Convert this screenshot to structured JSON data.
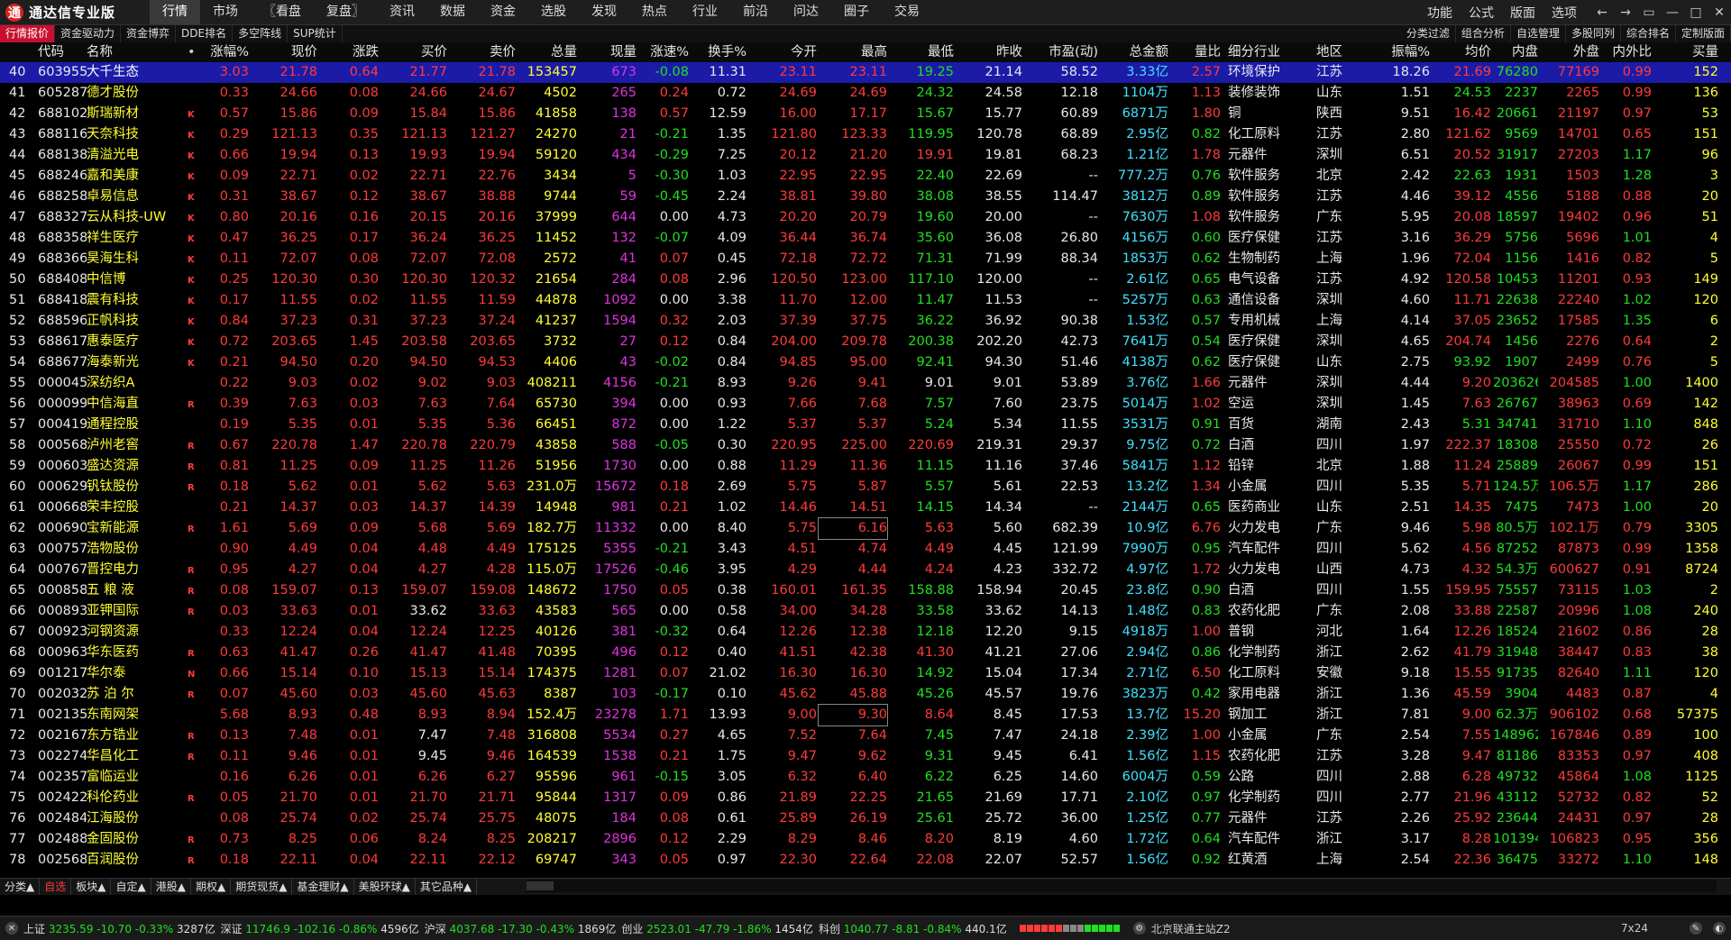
{
  "app": {
    "title": "通达信专业版",
    "logo_glyph": "通"
  },
  "menu": {
    "items": [
      "行情",
      "市场",
      "〖看盘",
      "复盘〗",
      "资讯",
      "数据",
      "资金",
      "选股",
      "发现",
      "热点",
      "行业",
      "前沿",
      "问达",
      "圈子",
      "交易"
    ],
    "active": 0
  },
  "right_menu": {
    "items": [
      "功能",
      "公式",
      "版面",
      "选项"
    ]
  },
  "window_controls": [
    "←",
    "→",
    "▭",
    "—",
    "□",
    "✕"
  ],
  "toolbar": {
    "left": [
      "行情报价",
      "资金驱动力",
      "资金博弈",
      "DDE排名",
      "多空阵线",
      "SUP统计"
    ],
    "right": [
      "分类过滤",
      "组合分析",
      "自选管理",
      "多股同列",
      "综合排名",
      "定制版面"
    ]
  },
  "columns": [
    "",
    "代码",
    "名称",
    "",
    "涨幅%",
    "现价",
    "涨跌",
    "买价",
    "卖价",
    "总量",
    "现量",
    "涨速%",
    "换手%",
    "今开",
    "最高",
    "最低",
    "昨收",
    "市盈(动)",
    "总金额",
    "量比",
    "细分行业",
    "地区",
    "振幅%",
    "均价",
    "内盘",
    "外盘",
    "内外比",
    "买量"
  ],
  "rows": [
    [
      "40",
      "603955",
      "大千生态",
      "",
      "3.03",
      "21.78",
      "0.64",
      "21.77",
      "21.78",
      "153457",
      "673",
      "-0.08",
      "11.31",
      "23.11",
      "23.11",
      "19.25",
      "21.14",
      "58.52",
      "3.33亿",
      "2.57",
      "环境保护",
      "江苏",
      "18.26",
      "21.69",
      "76280",
      "77169",
      "0.99",
      "152"
    ],
    [
      "41",
      "605287",
      "德才股份",
      "",
      "0.33",
      "24.66",
      "0.08",
      "24.66",
      "24.67",
      "4502",
      "265",
      "0.24",
      "0.72",
      "24.69",
      "24.69",
      "24.32",
      "24.58",
      "12.18",
      "1104万",
      "1.13",
      "装修装饰",
      "山东",
      "1.51",
      "24.53",
      "2237",
      "2265",
      "0.99",
      "136"
    ],
    [
      "42",
      "688102",
      "斯瑞新材",
      "K",
      "0.57",
      "15.86",
      "0.09",
      "15.84",
      "15.86",
      "41858",
      "138",
      "0.57",
      "12.59",
      "16.00",
      "17.17",
      "15.67",
      "15.77",
      "60.89",
      "6871万",
      "1.80",
      "铜",
      "陕西",
      "9.51",
      "16.42",
      "20661",
      "21197",
      "0.97",
      "53"
    ],
    [
      "43",
      "688116",
      "天奈科技",
      "K",
      "0.29",
      "121.13",
      "0.35",
      "121.13",
      "121.27",
      "24270",
      "21",
      "-0.21",
      "1.35",
      "121.80",
      "123.33",
      "119.95",
      "120.78",
      "68.89",
      "2.95亿",
      "0.82",
      "化工原料",
      "江苏",
      "2.80",
      "121.62",
      "9569",
      "14701",
      "0.65",
      "151"
    ],
    [
      "44",
      "688138",
      "清溢光电",
      "K",
      "0.66",
      "19.94",
      "0.13",
      "19.93",
      "19.94",
      "59120",
      "434",
      "-0.29",
      "7.25",
      "20.12",
      "21.20",
      "19.91",
      "19.81",
      "68.23",
      "1.21亿",
      "1.78",
      "元器件",
      "深圳",
      "6.51",
      "20.52",
      "31917",
      "27203",
      "1.17",
      "96"
    ],
    [
      "45",
      "688246",
      "嘉和美康",
      "K",
      "0.09",
      "22.71",
      "0.02",
      "22.71",
      "22.76",
      "3434",
      "5",
      "-0.30",
      "1.03",
      "22.95",
      "22.95",
      "22.40",
      "22.69",
      "--",
      "777.2万",
      "0.76",
      "软件服务",
      "北京",
      "2.42",
      "22.63",
      "1931",
      "1503",
      "1.28",
      "3"
    ],
    [
      "46",
      "688258",
      "卓易信息",
      "K",
      "0.31",
      "38.67",
      "0.12",
      "38.67",
      "38.88",
      "9744",
      "59",
      "-0.45",
      "2.24",
      "38.81",
      "39.80",
      "38.08",
      "38.55",
      "114.47",
      "3812万",
      "0.89",
      "软件服务",
      "江苏",
      "4.46",
      "39.12",
      "4556",
      "5188",
      "0.88",
      "20"
    ],
    [
      "47",
      "688327",
      "云从科技-UW",
      "K",
      "0.80",
      "20.16",
      "0.16",
      "20.15",
      "20.16",
      "37999",
      "644",
      "0.00",
      "4.73",
      "20.20",
      "20.79",
      "19.60",
      "20.00",
      "--",
      "7630万",
      "1.08",
      "软件服务",
      "广东",
      "5.95",
      "20.08",
      "18597",
      "19402",
      "0.96",
      "51"
    ],
    [
      "48",
      "688358",
      "祥生医疗",
      "K",
      "0.47",
      "36.25",
      "0.17",
      "36.24",
      "36.25",
      "11452",
      "132",
      "-0.07",
      "4.09",
      "36.44",
      "36.74",
      "35.60",
      "36.08",
      "26.80",
      "4156万",
      "0.60",
      "医疗保健",
      "江苏",
      "3.16",
      "36.29",
      "5756",
      "5696",
      "1.01",
      "4"
    ],
    [
      "49",
      "688366",
      "昊海生科",
      "K",
      "0.11",
      "72.07",
      "0.08",
      "72.07",
      "72.08",
      "2572",
      "41",
      "0.07",
      "0.45",
      "72.18",
      "72.72",
      "71.31",
      "71.99",
      "88.34",
      "1853万",
      "0.62",
      "生物制药",
      "上海",
      "1.96",
      "72.04",
      "1156",
      "1416",
      "0.82",
      "5"
    ],
    [
      "50",
      "688408",
      "中信博",
      "K",
      "0.25",
      "120.30",
      "0.30",
      "120.30",
      "120.32",
      "21654",
      "284",
      "0.08",
      "2.96",
      "120.50",
      "123.00",
      "117.10",
      "120.00",
      "--",
      "2.61亿",
      "0.65",
      "电气设备",
      "江苏",
      "4.92",
      "120.58",
      "10453",
      "11201",
      "0.93",
      "149"
    ],
    [
      "51",
      "688418",
      "震有科技",
      "K",
      "0.17",
      "11.55",
      "0.02",
      "11.55",
      "11.59",
      "44878",
      "1092",
      "0.00",
      "3.38",
      "11.70",
      "12.00",
      "11.47",
      "11.53",
      "--",
      "5257万",
      "0.63",
      "通信设备",
      "深圳",
      "4.60",
      "11.71",
      "22638",
      "22240",
      "1.02",
      "120"
    ],
    [
      "52",
      "688596",
      "正帆科技",
      "K",
      "0.84",
      "37.23",
      "0.31",
      "37.23",
      "37.24",
      "41237",
      "1594",
      "0.32",
      "2.03",
      "37.39",
      "37.75",
      "36.22",
      "36.92",
      "90.38",
      "1.53亿",
      "0.57",
      "专用机械",
      "上海",
      "4.14",
      "37.05",
      "23652",
      "17585",
      "1.35",
      "6"
    ],
    [
      "53",
      "688617",
      "惠泰医疗",
      "K",
      "0.72",
      "203.65",
      "1.45",
      "203.58",
      "203.65",
      "3732",
      "27",
      "0.12",
      "0.84",
      "204.00",
      "209.78",
      "200.38",
      "202.20",
      "42.73",
      "7641万",
      "0.54",
      "医疗保健",
      "深圳",
      "4.65",
      "204.74",
      "1456",
      "2276",
      "0.64",
      "2"
    ],
    [
      "54",
      "688677",
      "海泰新光",
      "K",
      "0.21",
      "94.50",
      "0.20",
      "94.50",
      "94.53",
      "4406",
      "43",
      "-0.02",
      "0.84",
      "94.85",
      "95.00",
      "92.41",
      "94.30",
      "51.46",
      "4138万",
      "0.62",
      "医疗保健",
      "山东",
      "2.75",
      "93.92",
      "1907",
      "2499",
      "0.76",
      "5"
    ],
    [
      "55",
      "000045",
      "深纺织A",
      "",
      "0.22",
      "9.03",
      "0.02",
      "9.02",
      "9.03",
      "408211",
      "4156",
      "-0.21",
      "8.93",
      "9.26",
      "9.41",
      "9.01",
      "9.01",
      "53.89",
      "3.76亿",
      "1.66",
      "元器件",
      "深圳",
      "4.44",
      "9.20",
      "203626",
      "204585",
      "1.00",
      "1400"
    ],
    [
      "56",
      "000099",
      "中信海直",
      "R",
      "0.39",
      "7.63",
      "0.03",
      "7.63",
      "7.64",
      "65730",
      "394",
      "0.00",
      "0.93",
      "7.66",
      "7.68",
      "7.57",
      "7.60",
      "23.75",
      "5014万",
      "1.02",
      "空运",
      "深圳",
      "1.45",
      "7.63",
      "26767",
      "38963",
      "0.69",
      "142"
    ],
    [
      "57",
      "000419",
      "通程控股",
      "",
      "0.19",
      "5.35",
      "0.01",
      "5.35",
      "5.36",
      "66451",
      "872",
      "0.00",
      "1.22",
      "5.37",
      "5.37",
      "5.24",
      "5.34",
      "11.55",
      "3531万",
      "0.91",
      "百货",
      "湖南",
      "2.43",
      "5.31",
      "34741",
      "31710",
      "1.10",
      "848"
    ],
    [
      "58",
      "000568",
      "泸州老窖",
      "R",
      "0.67",
      "220.78",
      "1.47",
      "220.78",
      "220.79",
      "43858",
      "588",
      "-0.05",
      "0.30",
      "220.95",
      "225.00",
      "220.69",
      "219.31",
      "29.37",
      "9.75亿",
      "0.72",
      "白酒",
      "四川",
      "1.97",
      "222.37",
      "18308",
      "25550",
      "0.72",
      "26"
    ],
    [
      "59",
      "000603",
      "盛达资源",
      "R",
      "0.81",
      "11.25",
      "0.09",
      "11.25",
      "11.26",
      "51956",
      "1730",
      "0.00",
      "0.88",
      "11.29",
      "11.36",
      "11.15",
      "11.16",
      "37.46",
      "5841万",
      "1.12",
      "铅锌",
      "北京",
      "1.88",
      "11.24",
      "25889",
      "26067",
      "0.99",
      "151"
    ],
    [
      "60",
      "000629",
      "钒钛股份",
      "R",
      "0.18",
      "5.62",
      "0.01",
      "5.62",
      "5.63",
      "231.0万",
      "15672",
      "0.18",
      "2.69",
      "5.75",
      "5.87",
      "5.57",
      "5.61",
      "22.53",
      "13.2亿",
      "1.34",
      "小金属",
      "四川",
      "5.35",
      "5.71",
      "124.5万",
      "106.5万",
      "1.17",
      "286"
    ],
    [
      "61",
      "000668",
      "荣丰控股",
      "",
      "0.21",
      "14.37",
      "0.03",
      "14.37",
      "14.39",
      "14948",
      "981",
      "0.21",
      "1.02",
      "14.46",
      "14.51",
      "14.15",
      "14.34",
      "--",
      "2144万",
      "0.65",
      "医药商业",
      "山东",
      "2.51",
      "14.35",
      "7475",
      "7473",
      "1.00",
      "20"
    ],
    [
      "62",
      "000690",
      "宝新能源",
      "R",
      "1.61",
      "5.69",
      "0.09",
      "5.68",
      "5.69",
      "182.7万",
      "11332",
      "0.00",
      "8.40",
      "5.75",
      "6.16",
      "5.63",
      "5.60",
      "682.39",
      "10.9亿",
      "6.76",
      "火力发电",
      "广东",
      "9.46",
      "5.98",
      "80.5万",
      "102.1万",
      "0.79",
      "3305"
    ],
    [
      "63",
      "000757",
      "浩物股份",
      "",
      "0.90",
      "4.49",
      "0.04",
      "4.48",
      "4.49",
      "175125",
      "5355",
      "-0.21",
      "3.43",
      "4.51",
      "4.74",
      "4.49",
      "4.45",
      "121.99",
      "7990万",
      "0.95",
      "汽车配件",
      "四川",
      "5.62",
      "4.56",
      "87252",
      "87873",
      "0.99",
      "1358"
    ],
    [
      "64",
      "000767",
      "晋控电力",
      "R",
      "0.95",
      "4.27",
      "0.04",
      "4.27",
      "4.28",
      "115.0万",
      "17526",
      "-0.46",
      "3.95",
      "4.29",
      "4.44",
      "4.24",
      "4.23",
      "332.72",
      "4.97亿",
      "1.72",
      "火力发电",
      "山西",
      "4.73",
      "4.32",
      "54.3万",
      "600627",
      "0.91",
      "8724"
    ],
    [
      "65",
      "000858",
      "五 粮 液",
      "R",
      "0.08",
      "159.07",
      "0.13",
      "159.07",
      "159.08",
      "148672",
      "1750",
      "0.05",
      "0.38",
      "160.01",
      "161.35",
      "158.88",
      "158.94",
      "20.45",
      "23.8亿",
      "0.90",
      "白酒",
      "四川",
      "1.55",
      "159.95",
      "75557",
      "73115",
      "1.03",
      "2"
    ],
    [
      "66",
      "000893",
      "亚钾国际",
      "R",
      "0.03",
      "33.63",
      "0.01",
      "33.62",
      "33.63",
      "43583",
      "565",
      "0.00",
      "0.58",
      "34.00",
      "34.28",
      "33.58",
      "33.62",
      "14.13",
      "1.48亿",
      "0.83",
      "农药化肥",
      "广东",
      "2.08",
      "33.88",
      "22587",
      "20996",
      "1.08",
      "240"
    ],
    [
      "67",
      "000923",
      "河钢资源",
      "",
      "0.33",
      "12.24",
      "0.04",
      "12.24",
      "12.25",
      "40126",
      "381",
      "-0.32",
      "0.64",
      "12.26",
      "12.38",
      "12.18",
      "12.20",
      "9.15",
      "4918万",
      "1.00",
      "普钢",
      "河北",
      "1.64",
      "12.26",
      "18524",
      "21602",
      "0.86",
      "28"
    ],
    [
      "68",
      "000963",
      "华东医药",
      "R",
      "0.63",
      "41.47",
      "0.26",
      "41.47",
      "41.48",
      "70395",
      "496",
      "0.12",
      "0.40",
      "41.51",
      "42.38",
      "41.30",
      "41.21",
      "27.06",
      "2.94亿",
      "0.86",
      "化学制药",
      "浙江",
      "2.62",
      "41.79",
      "31948",
      "38447",
      "0.83",
      "38"
    ],
    [
      "69",
      "001217",
      "华尔泰",
      "N",
      "0.66",
      "15.14",
      "0.10",
      "15.13",
      "15.14",
      "174375",
      "1281",
      "0.07",
      "21.02",
      "16.30",
      "16.30",
      "14.92",
      "15.04",
      "17.34",
      "2.71亿",
      "6.50",
      "化工原料",
      "安徽",
      "9.18",
      "15.55",
      "91735",
      "82640",
      "1.11",
      "120"
    ],
    [
      "70",
      "002032",
      "苏 泊 尔",
      "R",
      "0.07",
      "45.60",
      "0.03",
      "45.60",
      "45.63",
      "8387",
      "103",
      "-0.17",
      "0.10",
      "45.62",
      "45.88",
      "45.26",
      "45.57",
      "19.76",
      "3823万",
      "0.42",
      "家用电器",
      "浙江",
      "1.36",
      "45.59",
      "3904",
      "4483",
      "0.87",
      "4"
    ],
    [
      "71",
      "002135",
      "东南网架",
      "",
      "5.68",
      "8.93",
      "0.48",
      "8.93",
      "8.94",
      "152.4万",
      "23278",
      "1.71",
      "13.93",
      "9.00",
      "9.30",
      "8.64",
      "8.45",
      "17.53",
      "13.7亿",
      "15.20",
      "钢加工",
      "浙江",
      "7.81",
      "9.00",
      "62.3万",
      "906102",
      "0.68",
      "57375"
    ],
    [
      "72",
      "002167",
      "东方锆业",
      "R",
      "0.13",
      "7.48",
      "0.01",
      "7.47",
      "7.48",
      "316808",
      "5534",
      "0.27",
      "4.65",
      "7.52",
      "7.64",
      "7.45",
      "7.47",
      "24.18",
      "2.39亿",
      "1.00",
      "小金属",
      "广东",
      "2.54",
      "7.55",
      "148962",
      "167846",
      "0.89",
      "100"
    ],
    [
      "73",
      "002274",
      "华昌化工",
      "R",
      "0.11",
      "9.46",
      "0.01",
      "9.45",
      "9.46",
      "164539",
      "1538",
      "0.21",
      "1.75",
      "9.47",
      "9.62",
      "9.31",
      "9.45",
      "6.41",
      "1.56亿",
      "1.15",
      "农药化肥",
      "江苏",
      "3.28",
      "9.47",
      "81186",
      "83353",
      "0.97",
      "408"
    ],
    [
      "74",
      "002357",
      "富临运业",
      "",
      "0.16",
      "6.26",
      "0.01",
      "6.26",
      "6.27",
      "95596",
      "961",
      "-0.15",
      "3.05",
      "6.32",
      "6.40",
      "6.22",
      "6.25",
      "14.60",
      "6004万",
      "0.59",
      "公路",
      "四川",
      "2.88",
      "6.28",
      "49732",
      "45864",
      "1.08",
      "1125"
    ],
    [
      "75",
      "002422",
      "科伦药业",
      "R",
      "0.05",
      "21.70",
      "0.01",
      "21.70",
      "21.71",
      "95844",
      "1317",
      "0.09",
      "0.86",
      "21.89",
      "22.25",
      "21.65",
      "21.69",
      "17.71",
      "2.10亿",
      "0.97",
      "化学制药",
      "四川",
      "2.77",
      "21.96",
      "43112",
      "52732",
      "0.82",
      "52"
    ],
    [
      "76",
      "002484",
      "江海股份",
      "",
      "0.08",
      "25.74",
      "0.02",
      "25.74",
      "25.75",
      "48075",
      "184",
      "0.08",
      "0.61",
      "25.89",
      "26.19",
      "25.61",
      "25.72",
      "36.00",
      "1.25亿",
      "0.77",
      "元器件",
      "江苏",
      "2.26",
      "25.92",
      "23644",
      "24431",
      "0.97",
      "28"
    ],
    [
      "77",
      "002488",
      "金固股份",
      "R",
      "0.73",
      "8.25",
      "0.06",
      "8.24",
      "8.25",
      "208217",
      "2896",
      "0.12",
      "2.29",
      "8.29",
      "8.46",
      "8.20",
      "8.19",
      "4.60",
      "1.72亿",
      "0.64",
      "汽车配件",
      "浙江",
      "3.17",
      "8.28",
      "101394",
      "106823",
      "0.95",
      "356"
    ],
    [
      "78",
      "002568",
      "百润股份",
      "R",
      "0.18",
      "22.11",
      "0.04",
      "22.11",
      "22.12",
      "69747",
      "343",
      "0.05",
      "0.97",
      "22.30",
      "22.64",
      "22.08",
      "22.07",
      "52.57",
      "1.56亿",
      "0.92",
      "红黄酒",
      "上海",
      "2.54",
      "22.36",
      "36475",
      "33272",
      "1.10",
      "148"
    ]
  ],
  "selected_row": 0,
  "bottom_tabs": [
    "分类▲",
    "自选",
    "板块▲",
    "自定▲",
    "港股▲",
    "期权▲",
    "期货现货▲",
    "基金理财▲",
    "美股环球▲",
    "其它品种▲"
  ],
  "bottom_active": 1,
  "status": {
    "sh": {
      "name": "上证",
      "value": "3235.59",
      "chg": "-10.70",
      "pct": "-0.33%",
      "amt": "3287亿"
    },
    "sz": {
      "name": "深证",
      "value": "11746.9",
      "chg": "-102.16",
      "pct": "-0.86%",
      "amt": "4596亿"
    },
    "hs": {
      "name": "沪深",
      "value": "4037.68",
      "chg": "-17.30",
      "pct": "-0.43%",
      "amt": "1869亿"
    },
    "cy": {
      "name": "创业",
      "value": "2523.01",
      "chg": "-47.79",
      "pct": "-1.86%",
      "amt": "1454亿"
    },
    "kc": {
      "name": "科创",
      "value": "1040.77",
      "chg": "-8.81",
      "pct": "-0.84%",
      "amt": "440.1亿"
    },
    "server": "北京联通主站Z2",
    "mode": "7x24"
  },
  "colors": {
    "up": "#ff3b3b",
    "down": "#20e020",
    "flat": "#e8e8e8",
    "volume": "#ffff33",
    "magenta": "#e033e0",
    "amount": "#40e0ff",
    "selected": "#1b1ba8"
  }
}
